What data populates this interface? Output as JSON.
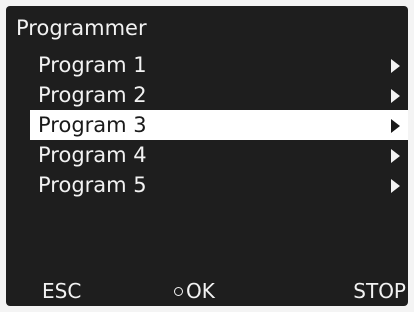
{
  "header": {
    "title": "Programmer"
  },
  "menu": {
    "items": [
      {
        "label": "Program 1",
        "icon": "chevron-right-icon"
      },
      {
        "label": "Program 2",
        "icon": "chevron-right-icon"
      },
      {
        "label": "Program 3",
        "icon": "chevron-right-icon",
        "selected": true
      },
      {
        "label": "Program 4",
        "icon": "chevron-right-icon"
      },
      {
        "label": "Program 5",
        "icon": "chevron-right-icon"
      }
    ]
  },
  "softkeys": {
    "esc_label": "ESC",
    "ok_label": "OK",
    "stop_label": "STOP"
  },
  "colors": {
    "screen_background": "#1e1e1e",
    "text": "#f2f2f2",
    "selection_background": "#ffffff",
    "selection_text": "#1a1a1a"
  }
}
